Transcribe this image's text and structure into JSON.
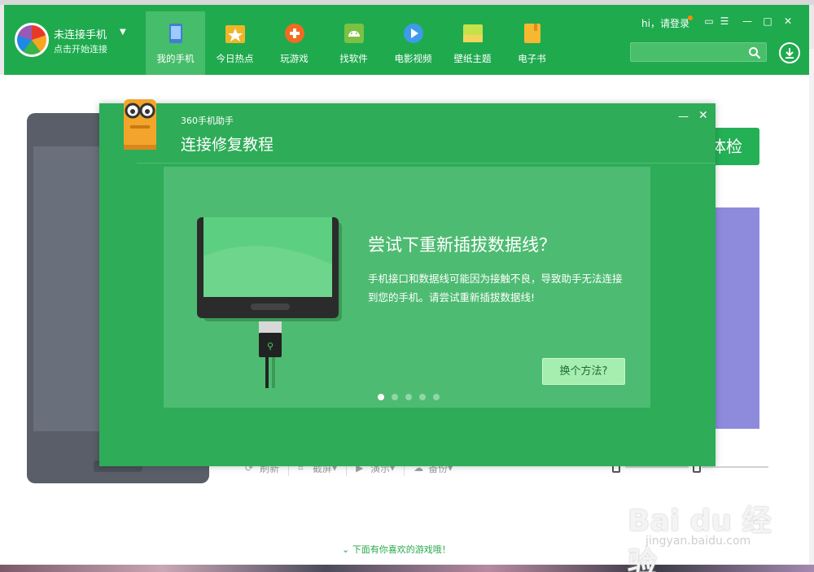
{
  "header": {
    "status_title": "未连接手机",
    "status_sub": "点击开始连接",
    "nav": [
      {
        "label": "我的手机",
        "icon": "phone-icon",
        "color": "#4a90d9"
      },
      {
        "label": "今日热点",
        "icon": "star-icon",
        "color": "#f0b429"
      },
      {
        "label": "玩游戏",
        "icon": "gamepad-icon",
        "color": "#f26b21"
      },
      {
        "label": "找软件",
        "icon": "android-icon",
        "color": "#7cc142"
      },
      {
        "label": "电影视频",
        "icon": "play-icon",
        "color": "#3d9be9"
      },
      {
        "label": "壁纸主题",
        "icon": "wallpaper-icon",
        "color": "#c6e24a"
      },
      {
        "label": "电子书",
        "icon": "book-icon",
        "color": "#f6b731"
      }
    ],
    "hi_login": "hi，请登录",
    "search_placeholder": ""
  },
  "modal": {
    "app_name": "360手机助手",
    "title": "连接修复教程",
    "slide_heading": "尝试下重新插拔数据线？",
    "slide_desc": "手机接口和数据线可能因为接触不良，导致助手无法连接到您的手机。请尝试重新插拔数据线!",
    "alt_button": "换个方法?",
    "slide_count": 5,
    "active_slide": 1
  },
  "background": {
    "check_label": "体检",
    "toolbar": [
      "刷新",
      "截屏",
      "演示",
      "备份"
    ],
    "more_games": "下面有你喜欢的游戏哦！"
  },
  "watermark": {
    "main": "Bai du 经验",
    "sub": "jingyan.baidu.com"
  },
  "colors": {
    "brand_green": "#1faa4e",
    "modal_green": "#2eac58"
  }
}
